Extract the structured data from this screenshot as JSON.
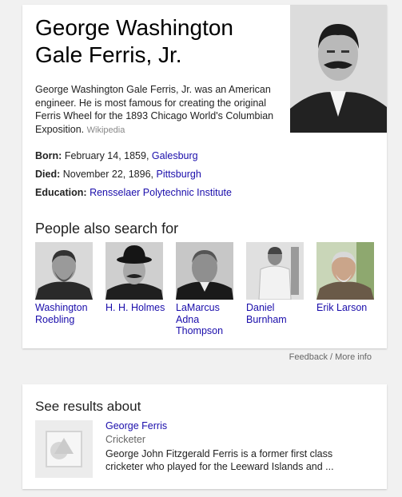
{
  "knowledge_panel": {
    "title_line1": "George Washington",
    "title_line2": "Gale Ferris, Jr.",
    "description": "George Washington Gale Ferris, Jr. was an American engineer. He is most famous for creating the original Ferris Wheel for the 1893 Chicago World's Columbian Exposition.",
    "description_source": "Wikipedia",
    "facts": [
      {
        "label": "Born:",
        "value": "February 14, 1859, ",
        "link": "Galesburg"
      },
      {
        "label": "Died:",
        "value": "November 22, 1896, ",
        "link": "Pittsburgh"
      },
      {
        "label": "Education:",
        "value": "",
        "link": "Rensselaer Polytechnic Institute"
      }
    ],
    "people_heading": "People also search for",
    "people": [
      {
        "name": "Washington Roebling"
      },
      {
        "name": "H. H. Holmes"
      },
      {
        "name": "LaMarcus Adna Thompson"
      },
      {
        "name": "Daniel Burnham"
      },
      {
        "name": "Erik Larson"
      }
    ]
  },
  "feedback_label": "Feedback / More info",
  "see_results": {
    "heading": "See results about",
    "name": "George Ferris",
    "subtitle": "Cricketer",
    "description": "George John Fitzgerald Ferris is a former first class cricketer who played for the Leeward Islands and ..."
  }
}
